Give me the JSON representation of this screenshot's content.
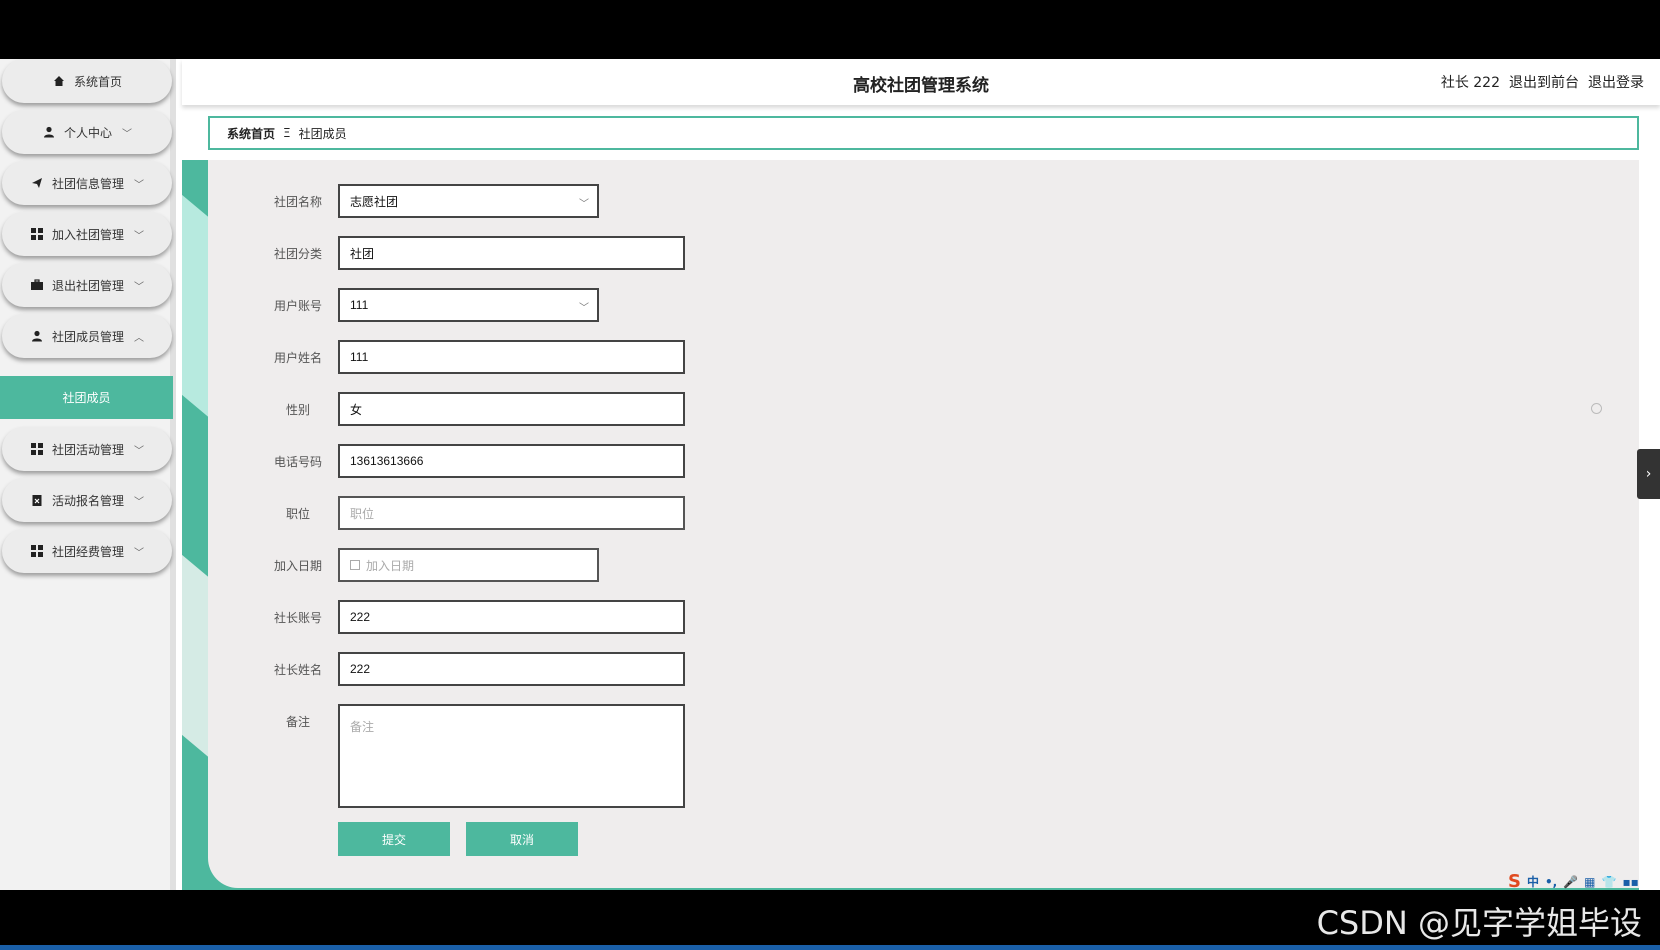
{
  "app_title": "高校社团管理系统",
  "header": {
    "user": "社长 222",
    "to_front": "退出到前台",
    "logout": "退出登录"
  },
  "sidebar": {
    "items": [
      {
        "label": "系统首页",
        "icon": "home-icon"
      },
      {
        "label": "个人中心",
        "icon": "user-icon"
      },
      {
        "label": "社团信息管理",
        "icon": "send-icon"
      },
      {
        "label": "加入社团管理",
        "icon": "grid-icon"
      },
      {
        "label": "退出社团管理",
        "icon": "briefcase-icon"
      },
      {
        "label": "社团成员管理",
        "icon": "user-icon"
      },
      {
        "label": "社团活动管理",
        "icon": "grid-icon"
      },
      {
        "label": "活动报名管理",
        "icon": "clipboard-icon"
      },
      {
        "label": "社团经费管理",
        "icon": "grid-icon"
      }
    ],
    "active_sub": "社团成员"
  },
  "breadcrumb": {
    "home": "系统首页",
    "sep": "Ξ",
    "current": "社团成员"
  },
  "form": {
    "club_name": {
      "label": "社团名称",
      "value": "志愿社团"
    },
    "club_type": {
      "label": "社团分类",
      "value": "社团"
    },
    "user_account": {
      "label": "用户账号",
      "value": "111"
    },
    "user_name": {
      "label": "用户姓名",
      "value": "111"
    },
    "gender": {
      "label": "性别",
      "value": "女"
    },
    "phone": {
      "label": "电话号码",
      "value": "13613613666"
    },
    "position": {
      "label": "职位",
      "placeholder": "职位"
    },
    "join_date": {
      "label": "加入日期",
      "placeholder": "加入日期"
    },
    "leader_account": {
      "label": "社长账号",
      "value": "222"
    },
    "leader_name": {
      "label": "社长姓名",
      "value": "222"
    },
    "remark": {
      "label": "备注",
      "placeholder": "备注"
    },
    "submit": "提交",
    "cancel": "取消"
  },
  "watermark": "CSDN @见字学姐毕设",
  "ime": {
    "logo": "S",
    "lang": "中"
  },
  "colors": {
    "accent": "#4db89e",
    "panel": "#efeded"
  }
}
